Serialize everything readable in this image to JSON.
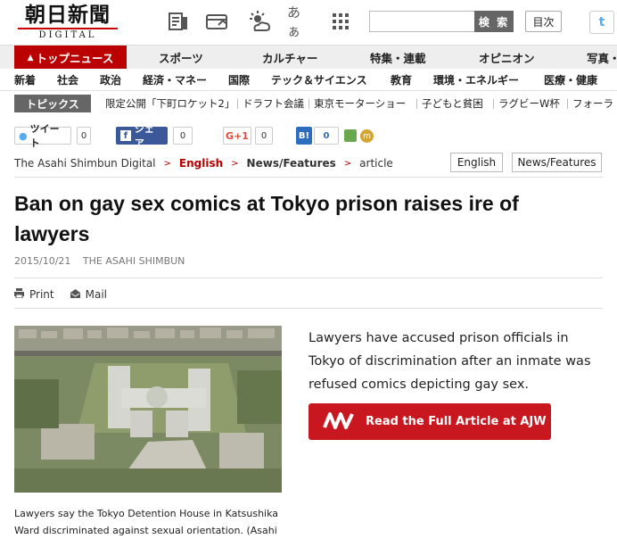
{
  "header": {
    "logo_jp": "朝日新聞",
    "logo_en": "DIGITAL",
    "icons": [
      "paper-edition-icon",
      "card-icon",
      "weather-icon",
      "font-size-icon",
      "grid-menu-icon"
    ],
    "font_size_glyph": "あぁ",
    "search_button": "検 索",
    "toc_button": "目次",
    "twitter_glyph": "t"
  },
  "nav_main": [
    "トップニュース",
    "スポーツ",
    "カルチャー",
    "特集・連載",
    "オピニオン",
    "写真・"
  ],
  "nav_sub": [
    "新着",
    "社会",
    "政治",
    "経済・マネー",
    "国際",
    "テック＆サイエンス",
    "教育",
    "環境・エネルギー",
    "医療・健康"
  ],
  "topics": {
    "label": "トピックス",
    "items": [
      "限定公開「下町ロケット2」",
      "ドラフト会議",
      "東京モーターショー",
      "子どもと貧困",
      "ラグビーW杯",
      "フォーラ"
    ]
  },
  "share": {
    "tweet": "ツイート",
    "tweet_count": "0",
    "fb_label": "シェア",
    "fb_count": "0",
    "gplus_label": "G+1",
    "gplus_count": "0",
    "hatena_label": "B!",
    "hatena_count": "0"
  },
  "breadcrumb": [
    "The Asahi Shimbun Digital",
    "English",
    "News/Features",
    "article"
  ],
  "tags": [
    "English",
    "News/Features"
  ],
  "article": {
    "title": "Ban on gay sex comics at Tokyo prison raises ire of lawyers",
    "date": "2015/10/21",
    "source": "THE ASAHI SHIMBUN",
    "print_label": "Print",
    "mail_label": "Mail",
    "lead": "Lawyers have accused prison officials in Tokyo of discrimination after an inmate was refused comics depicting gay sex.",
    "ajw_button": "Read the Full Article at AJW",
    "caption": "Lawyers say the Tokyo Detention House in Katsushika Ward discriminated against sexual orientation. (Asahi"
  },
  "colors": {
    "brand_red": "#b00000",
    "ajw_red": "#c8171e",
    "facebook_blue": "#3b5998",
    "gplus_red": "#dd4b39",
    "hatena_blue": "#2c6ebd"
  }
}
